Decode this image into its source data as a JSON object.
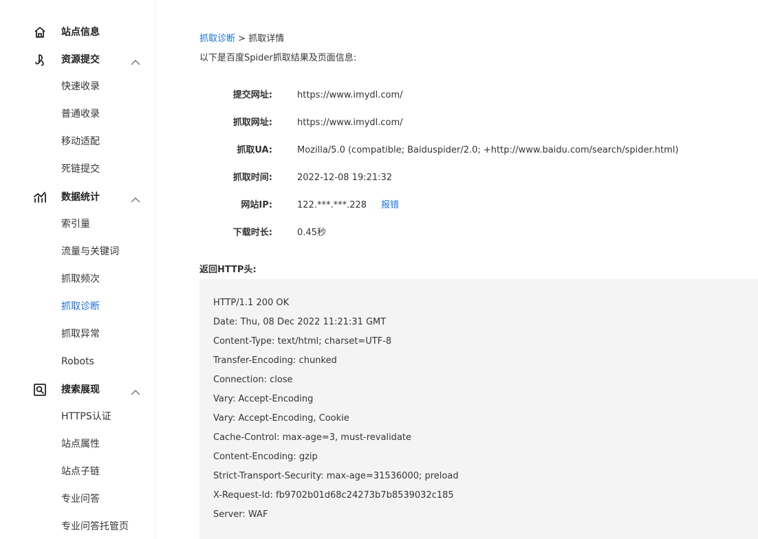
{
  "sidebar": {
    "groups": [
      {
        "label": "站点信息",
        "icon": "home-icon"
      },
      {
        "label": "资源提交",
        "icon": "resource-submit-icon"
      },
      {
        "label": "数据统计",
        "icon": "statistics-icon"
      },
      {
        "label": "搜索展现",
        "icon": "search-display-icon"
      }
    ],
    "resource_items": [
      "快速收录",
      "普通收录",
      "移动适配",
      "死链提交"
    ],
    "stats_items": [
      "索引量",
      "流量与关键词",
      "抓取频次",
      "抓取诊断",
      "抓取异常",
      "Robots"
    ],
    "display_items": [
      "HTTPS认证",
      "站点属性",
      "站点子链",
      "专业问答",
      "专业问答托管页"
    ],
    "active_item": "抓取诊断",
    "active_color": "#1a6fe8"
  },
  "main": {
    "breadcrumb": {
      "link": "抓取诊断",
      "separator": " > ",
      "current": "抓取详情"
    },
    "intro": "以下是百度Spider抓取结果及页面信息:",
    "fields": [
      {
        "label": "提交网址:",
        "value": "https://www.imydl.com/"
      },
      {
        "label": "抓取网址:",
        "value": "https://www.imydl.com/"
      },
      {
        "label": "抓取UA:",
        "value": "Mozilla/5.0 (compatible; Baiduspider/2.0; +http://www.baidu.com/search/spider.html)"
      },
      {
        "label": "抓取时间:",
        "value": "2022-12-08 19:21:32"
      },
      {
        "label": "网站IP:",
        "value": "122.***.***.228",
        "action": "报错"
      },
      {
        "label": "下载时长:",
        "value": "0.45秒"
      }
    ],
    "http_header_title": "返回HTTP头:",
    "http_headers": [
      "HTTP/1.1 200 OK",
      "Date: Thu, 08 Dec 2022 11:21:31 GMT",
      "Content-Type: text/html; charset=UTF-8",
      "Transfer-Encoding: chunked",
      "Connection: close",
      "Vary: Accept-Encoding",
      "Vary: Accept-Encoding, Cookie",
      "Cache-Control: max-age=3, must-revalidate",
      "Content-Encoding: gzip",
      "Strict-Transport-Security: max-age=31536000; preload",
      "X-Request-Id: fb9702b01d68c24273b7b8539032c185",
      "Server: WAF"
    ]
  }
}
